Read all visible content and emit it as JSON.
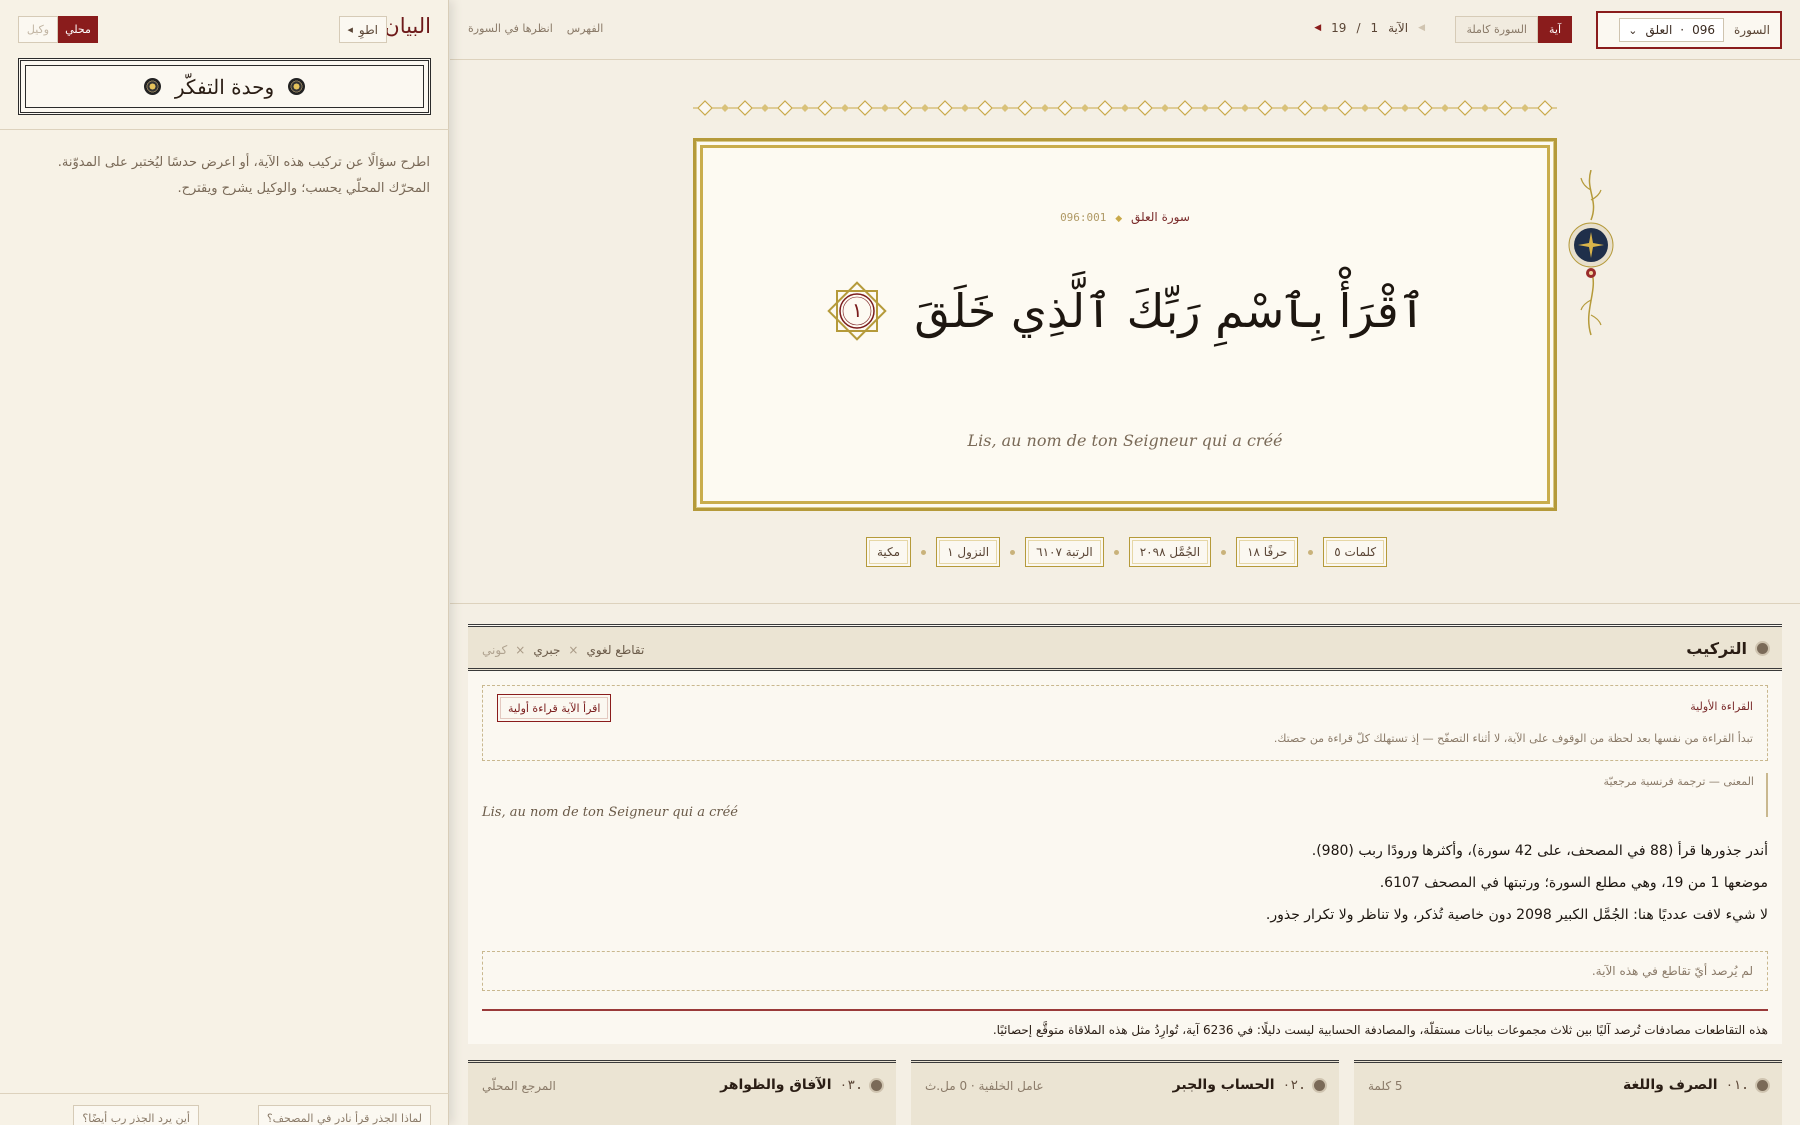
{
  "left_panel": {
    "title": "البيان",
    "collapse_label": "اطوِ",
    "mode_local": "محلي",
    "mode_agent": "وكيل",
    "unit_label": "وحدة التفكّر",
    "description": "اطرح سؤالًا عن تركيب هذه الآية، أو اعرض حدسًا ليُختبر على المدوّنة. المحرّك المحلّي يحسب؛ والوكيل يشرح ويقترح.",
    "suggestions": [
      "لماذا الجذر قرأ نادر في المصحف؟",
      "أين يرد الجذر رب أيضًا؟"
    ]
  },
  "topbar": {
    "surah_label": "السورة",
    "surah_number": "096",
    "surah_name": "العلق",
    "view_ayah": "آية",
    "view_full": "السورة كاملة",
    "ayah_label": "الآية",
    "ayah_current": "1",
    "ayah_sep": "/",
    "ayah_total": "19",
    "link_view_in_surah": "انظرها في السورة",
    "link_index": "الفهرس"
  },
  "verse": {
    "surah_ref_name": "سورة العلق",
    "ref_code": "096:001",
    "arabic_text": "ٱقْرَأْ بِٱسْمِ رَبِّكَ ٱلَّذِي خَلَقَ",
    "ayah_number": "١",
    "translation": "Lis, au nom de ton Seigneur qui a créé"
  },
  "metrics": [
    {
      "label": "كلمات ٥"
    },
    {
      "label": "حرفًا ١٨"
    },
    {
      "label": "الجُمَّل ٢٠٩٨"
    },
    {
      "label": "الرتبة ٦١٠٧"
    },
    {
      "label": "النزول ١"
    },
    {
      "label": "مكية"
    }
  ],
  "composition": {
    "title": "التركيب",
    "filters": [
      "تقاطع لغوي",
      "جبري",
      "كوني"
    ],
    "first_reading_title": "القراءة الأولية",
    "first_reading_button": "اقرأ الآية قراءة أولية",
    "first_reading_note": "تبدأ القراءة من نفسها بعد لحظة من الوقوف على الآية، لا أثناء التصفّح — إذ تستهلك كلّ قراءة من حصتك.",
    "meaning_label": "المعنى — ترجمة فرنسية مرجعيّة",
    "meaning_text": "Lis, au nom de ton Seigneur qui a créé",
    "lines": [
      "أندر جذورها قرأ (88 في المصحف، على 42 سورة)، وأكثرها ورودًا ربب (980).",
      "موضعها 1 من 19، وهي مطلع السورة؛ ورتبتها في المصحف 6107.",
      "لا شيء لافت عدديًا هنا: الجُمَّل الكبير 2098 دون خاصية تُذكر، ولا تناظر ولا تكرار جذور."
    ],
    "no_intersections": "لم يُرصد أيّ تقاطع في هذه الآية.",
    "footnote": "هذه التقاطعات مصادفات تُرصد آليًا بين ثلاث مجموعات بيانات مستقلّة، والمصادفة الحسابية ليست دليلًا: في 6236 آية، تُوارِدُ مثل هذه الملاقاة متوقَّع إحصائيًا."
  },
  "cards": [
    {
      "num": ".٠١",
      "title": "الصرف واللغة",
      "meta": "5 كلمة"
    },
    {
      "num": ".٠٢",
      "title": "الحساب والجبر",
      "meta": "عامل الخلفية · 0 مل.ث"
    },
    {
      "num": ".٠٣",
      "title": "الآفاق والظواهر",
      "meta": "المرجع المحلّي"
    }
  ],
  "colors": {
    "accent": "#8a1c1c",
    "gold": "#b59a3a",
    "paper": "#fbf8f1"
  }
}
